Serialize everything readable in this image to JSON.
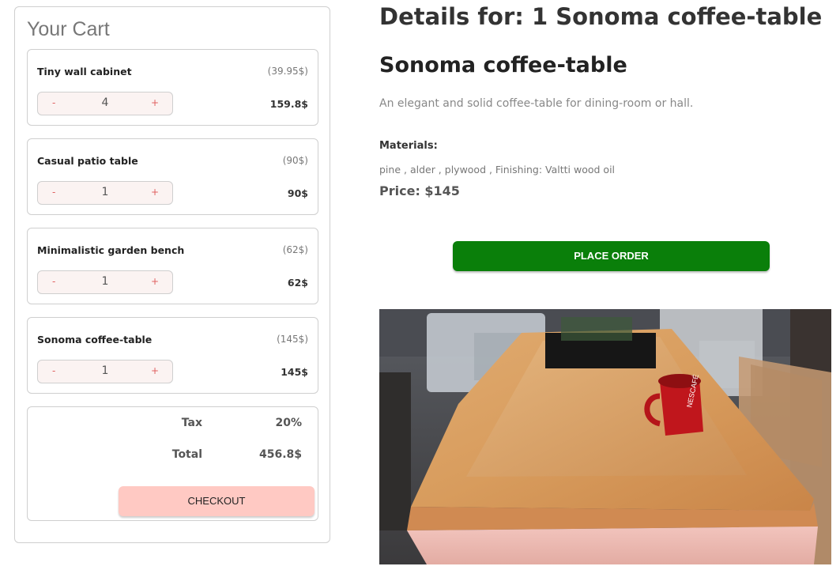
{
  "cart": {
    "title": "Your Cart",
    "items": [
      {
        "name": "Tiny wall cabinet",
        "unit_price": "(39.95$)",
        "qty": "4",
        "total": "159.8$",
        "minus": "-",
        "plus": "+"
      },
      {
        "name": "Casual patio table",
        "unit_price": "(90$)",
        "qty": "1",
        "total": "90$",
        "minus": "-",
        "plus": "+"
      },
      {
        "name": "Minimalistic garden bench",
        "unit_price": "(62$)",
        "qty": "1",
        "total": "62$",
        "minus": "-",
        "plus": "+"
      },
      {
        "name": "Sonoma coffee-table",
        "unit_price": "(145$)",
        "qty": "1",
        "total": "145$",
        "minus": "-",
        "plus": "+"
      }
    ],
    "summary": {
      "tax_label": "Tax",
      "tax_value": "20%",
      "total_label": "Total",
      "total_value": "456.8$",
      "checkout_label": "CHECKOUT"
    }
  },
  "details": {
    "heading": "Details for: 1 Sonoma coffee-table",
    "product_name": "Sonoma coffee-table",
    "description": "An elegant and solid coffee-table for dining-room or hall.",
    "materials_label": "Materials:",
    "materials": "pine , alder , plywood , Finishing: Valtti wood oil",
    "price": "Price: $145",
    "place_order_label": "PLACE ORDER",
    "image_icon": "coffee-table-photo",
    "colors": {
      "place_order": "#0a7f0a",
      "checkout": "#ffc9c3",
      "wood": "#d69a5e",
      "mug": "#c0161c"
    }
  }
}
